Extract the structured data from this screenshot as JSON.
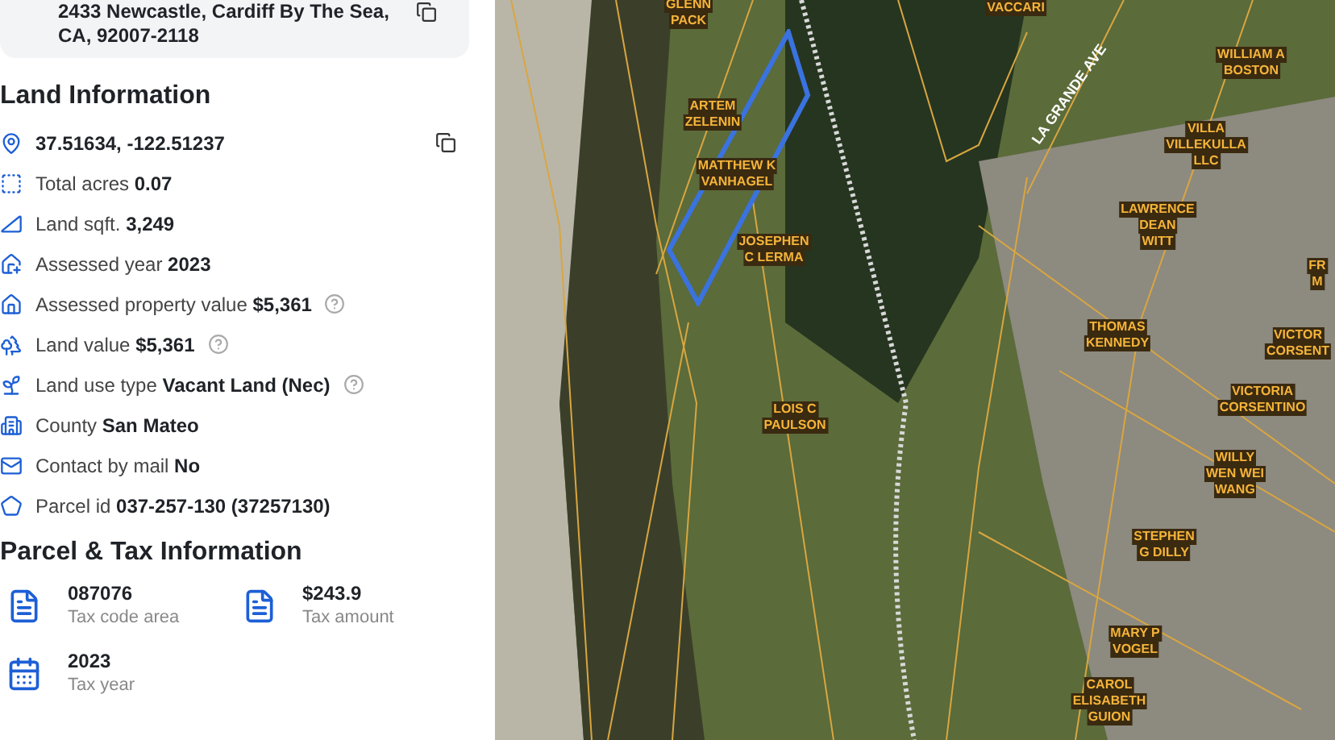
{
  "address": {
    "lines": [
      "2433 Newcastle, Cardiff By The Sea,",
      "CA, 92007-2118"
    ]
  },
  "land_information": {
    "title": "Land Information",
    "coordinates": "37.51634, -122.51237",
    "rows": [
      {
        "kind": "acres",
        "label": "Total acres",
        "value": "0.07",
        "help": false
      },
      {
        "kind": "sqft",
        "label": "Land sqft.",
        "value": "3,249",
        "help": false
      },
      {
        "kind": "year",
        "label": "Assessed year",
        "value": "2023",
        "help": false
      },
      {
        "kind": "property",
        "label": "Assessed property value",
        "value": "$5,361",
        "help": true
      },
      {
        "kind": "land",
        "label": "Land value",
        "value": "$5,361",
        "help": true
      },
      {
        "kind": "use",
        "label": "Land use type",
        "value": "Vacant Land (Nec)",
        "help": true
      },
      {
        "kind": "county",
        "label": "County",
        "value": "San Mateo",
        "help": false
      },
      {
        "kind": "mail",
        "label": "Contact by mail",
        "value": "No",
        "help": false
      },
      {
        "kind": "parcel",
        "label": "Parcel id",
        "value": "037-257-130 (37257130)",
        "help": false
      }
    ]
  },
  "parcel_tax": {
    "title": "Parcel & Tax Information",
    "items": [
      {
        "kind": "tax",
        "value": "087076",
        "label": "Tax code area"
      },
      {
        "kind": "tax",
        "value": "$243.9",
        "label": "Tax amount"
      },
      {
        "kind": "calendar",
        "value": "2023",
        "label": "Tax year"
      }
    ]
  },
  "map": {
    "street_label": "LA GRANDE AVE",
    "parcel_labels": [
      {
        "lines": [
          "GLENN",
          "PACK"
        ]
      },
      {
        "lines": [
          "VACCARI"
        ]
      },
      {
        "lines": [
          "WILLIAM A",
          "BOSTON"
        ]
      },
      {
        "lines": [
          "ARTEM",
          "ZELENIN"
        ]
      },
      {
        "lines": [
          "MATTHEW K",
          "VANHAGEL"
        ]
      },
      {
        "lines": [
          "JOSEPHEN",
          "C LERMA"
        ]
      },
      {
        "lines": [
          "VILLA",
          "VILLEKULLA",
          "LLC"
        ]
      },
      {
        "lines": [
          "LAWRENCE",
          "DEAN",
          "WITT"
        ]
      },
      {
        "lines": [
          "THOMAS",
          "KENNEDY"
        ]
      },
      {
        "lines": [
          "FR",
          "M"
        ]
      },
      {
        "lines": [
          "VICTOR",
          "CORSENT"
        ]
      },
      {
        "lines": [
          "VICTORIA",
          "CORSENTINO"
        ]
      },
      {
        "lines": [
          "LOIS C",
          "PAULSON"
        ]
      },
      {
        "lines": [
          "WILLY",
          "WEN WEI",
          "WANG"
        ]
      },
      {
        "lines": [
          "STEPHEN",
          "G DILLY"
        ]
      },
      {
        "lines": [
          "MARY P",
          "VOGEL"
        ]
      },
      {
        "lines": [
          "CAROL",
          "ELISABETH",
          "GUION"
        ]
      }
    ]
  }
}
